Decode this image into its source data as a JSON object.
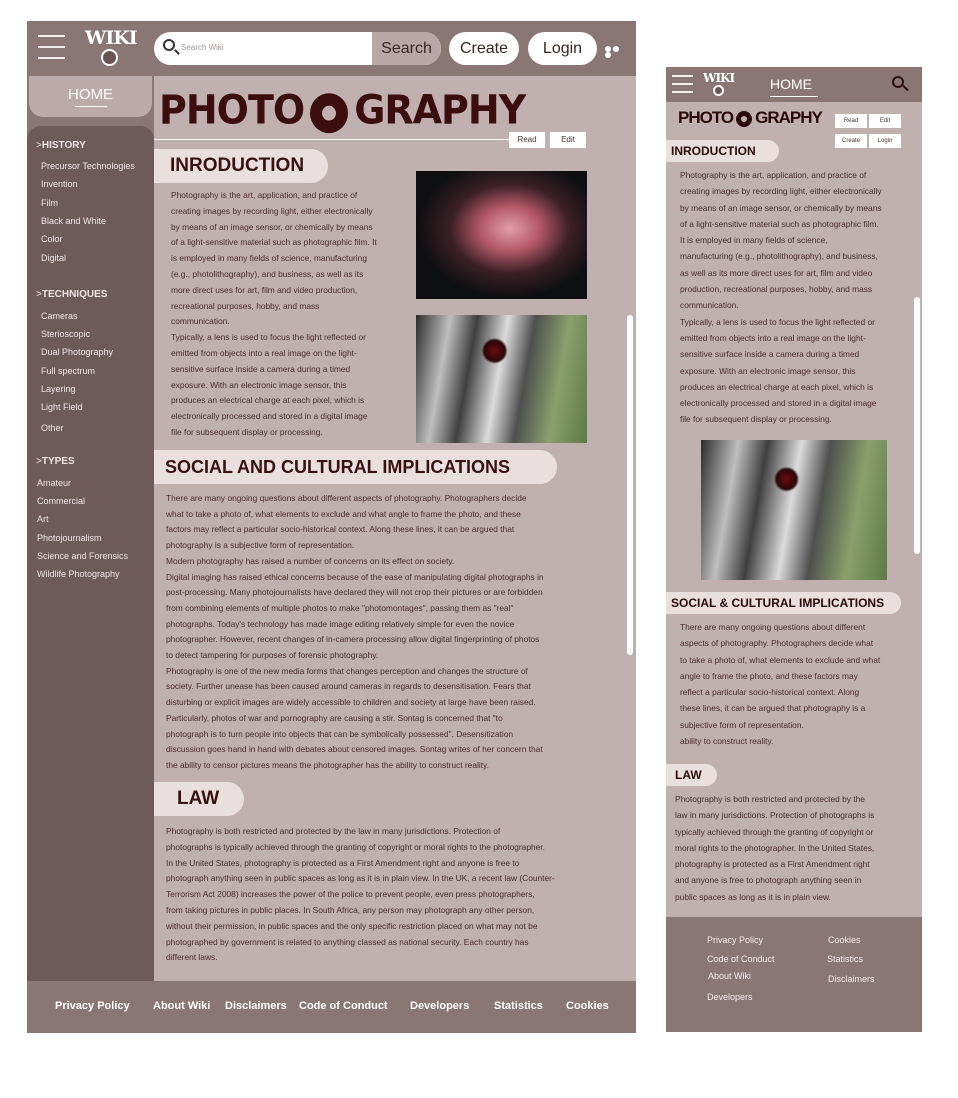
{
  "desktop": {
    "logo": "WIKI",
    "search": {
      "placeholder": "Search Wiki",
      "button": "Search"
    },
    "create": "Create",
    "login": "Login",
    "home": "HOME",
    "sidebar": [
      {
        "title": "HISTORY",
        "items": [
          "Precursor Technologies",
          "Invention",
          "Film",
          "Black and White",
          "Color",
          "Digital"
        ]
      },
      {
        "title": "TECHNIQUES",
        "items": [
          "Cameras",
          "Sterioscopic",
          "Dual Photography",
          "Full spectrum",
          "Layering",
          "Light Field",
          "Other"
        ]
      },
      {
        "title": "TYPES",
        "items": [
          "Amateur",
          "Commercial",
          "Art",
          "Photojournalism",
          "Science and Forensics",
          "Wildlife Photography"
        ]
      }
    ],
    "title_left": "PHOTO",
    "title_right": "GRAPHY",
    "read": "Read",
    "edit": "Edit",
    "intro_heading": "INRODUCTION",
    "intro_lines": [
      "Photography is the art, application, and practice of",
      "creating images by recording light, either electronically",
      "by means of an image sensor, or chemically by means",
      "of a light-sensitive material such as photographic film. It",
      "is employed in many fields of science, manufacturing",
      "(e.g., photolithography), and business, as well as its",
      "more direct uses for art, film and video production,",
      "recreational purposes, hobby, and mass",
      "communication.",
      "Typically, a lens is used to focus the light reflected or",
      "emitted from objects into a real image on the light-",
      "sensitive surface inside a camera during a timed",
      "exposure. With an electronic image sensor, this",
      "produces an electrical charge at each pixel, which is",
      "electronically processed and stored in a digital image",
      "file for subsequent display or processing."
    ],
    "social_heading": "SOCIAL AND CULTURAL IMPLICATIONS",
    "social_lines": [
      "There are many ongoing questions about different aspects of photography. Photographers decide",
      "what to take a photo of, what elements to exclude and what angle to frame the photo, and these",
      "factors may reflect a particular socio-historical context. Along these lines, it can be argued that",
      "photography is a subjective form of representation.",
      "Modern photography has raised a number of concerns on its effect on society.",
      "Digital imaging has raised ethical concerns because of the ease of manipulating digital photographs in",
      "post-processing. Many photojournalists have declared they will not crop their pictures or are forbidden",
      "from combining elements of multiple photos to make \"photomontages\", passing them as \"real\"",
      "photographs. Today's technology has made image editing relatively simple for even the novice",
      "photographer. However, recent changes of in-camera processing allow digital fingerprinting of photos",
      "to detect tampering for purposes of forensic photography.",
      "Photography is one of the new media forms that changes perception and changes the structure of",
      "society. Further unease has been caused around cameras in regards to desensitisation. Fears that",
      "disturbing or explicit images are widely accessible to children and society at large have been raised.",
      "Particularly, photos of war and pornography are causing a stir. Sontag is concerned that \"to",
      "photograph is to turn people into objects that can be symbolically possessed\". Desensitization",
      "discussion goes hand in hand with debates about censored images. Sontag writes of her concern that",
      "the ability to censor pictures means the photographer has the ability to construct reality."
    ],
    "law_heading": "LAW",
    "law_lines": [
      "Photography is both restricted and protected by the law in many jurisdictions. Protection of",
      "photographs is typically achieved through the granting of copyright or moral rights to the photographer.",
      "In the United States, photography is protected as a First Amendment right and anyone is free to",
      "photograph anything seen in public spaces as long as it is in plain view. In the UK, a recent law (Counter-",
      "Terrorism Act 2008) increases the power of the police to prevent people, even press photographers,",
      "from taking pictures in public places. In South Africa, any person may photograph any other person,",
      "without their permission, in public spaces and the only specific restriction placed on what may not be",
      "photographed by government is related to anything classed as national security. Each country has",
      "different laws."
    ],
    "footer": [
      "Privacy Policy",
      "About Wiki",
      "Disclaimers",
      "Code of Conduct",
      "Developers",
      "Statistics",
      "Cookies"
    ]
  },
  "mobile": {
    "logo": "WIKI",
    "home": "HOME",
    "title_left": "PHOTO",
    "title_right": "GRAPHY",
    "read": "Read",
    "edit": "Edit",
    "create": "Create",
    "login": "Login",
    "intro_heading": "INRODUCTION",
    "intro_lines": [
      "Photography is the art, application, and practice of",
      "creating images by recording light, either electronically",
      "by means of an image sensor, or chemically by means",
      "of a light-sensitive material such as photographic film.",
      "It is employed in many fields of science,",
      "manufacturing (e.g., photolithography), and business,",
      "as well as its more direct uses for art, film and video",
      "production, recreational purposes, hobby, and mass",
      "communication.",
      "Typically, a lens is used to focus the light reflected or",
      "emitted from objects into a real image on the light-",
      "sensitive surface inside a camera during a timed",
      "exposure. With an electronic image sensor, this",
      "produces an electrical charge at each pixel, which is",
      "electronically processed and stored in a digital image",
      "file for subsequent display or processing."
    ],
    "social_heading": "SOCIAL & CULTURAL IMPLICATIONS",
    "social_lines": [
      "There are many ongoing questions about different",
      "aspects of photography. Photographers decide what",
      "to take a photo of, what elements to exclude and what",
      "angle to frame the photo, and these factors may",
      "reflect a particular socio-historical context. Along",
      "these lines, it can be argued that photography is a",
      "subjective form of representation.",
      "ability to construct reality."
    ],
    "law_heading": "LAW",
    "law_lines": [
      "Photography is both restricted and protected by the",
      "law in many jurisdictions. Protection of photographs is",
      "typically achieved through the granting of copyright or",
      "moral rights to the photographer. In the United States,",
      "photography is protected as a First Amendment right",
      "and anyone is free to photograph anything seen in",
      "public spaces as long as it is in plain view."
    ],
    "footer_left": [
      "Privacy Policy",
      "Code of Conduct",
      "About Wiki",
      "Developers"
    ],
    "footer_right": [
      "Cookies",
      "Statistics",
      "Disclaimers"
    ]
  }
}
